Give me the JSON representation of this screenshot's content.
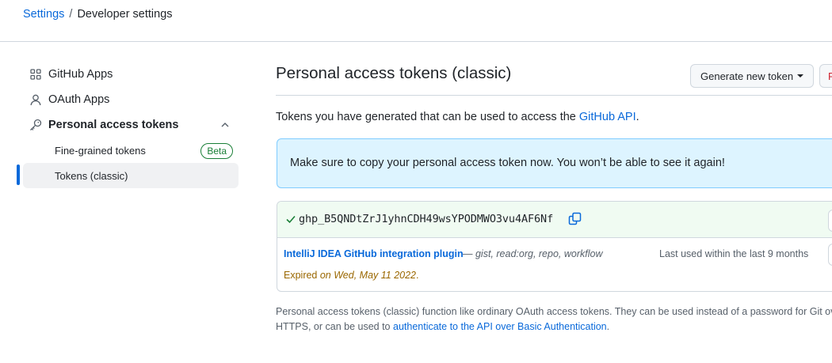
{
  "breadcrumb": {
    "root": "Settings",
    "separator": "/",
    "current": "Developer settings"
  },
  "sidebar": {
    "items": [
      {
        "label": "GitHub Apps",
        "icon": "apps-grid-icon"
      },
      {
        "label": "OAuth Apps",
        "icon": "person-icon"
      },
      {
        "label": "Personal access tokens",
        "icon": "key-icon",
        "expanded": true
      }
    ],
    "subitems": [
      {
        "label": "Fine-grained tokens",
        "badge": "Beta"
      },
      {
        "label": "Tokens (classic)",
        "active": true
      }
    ]
  },
  "main": {
    "title": "Personal access tokens (classic)",
    "generate_label": "Generate new token",
    "revoke_label": "R",
    "intro_text": "Tokens you have generated that can be used to access the ",
    "intro_link": "GitHub API",
    "intro_end": ".",
    "flash": "Make sure to copy your personal access token now. You won’t be able to see it again!",
    "token": {
      "value": "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",
      "name": "IntelliJ IDEA GitHub integration plugin",
      "scope_sep": " — ",
      "scopes": "gist, read:org, repo, workflow",
      "last_used": "Last used within the last 9 months",
      "expired_prefix": "Expired ",
      "expired_date": "on Wed, May 11 2022",
      "expired_suffix": "."
    },
    "footnote_text": "Personal access tokens (classic) function like ordinary OAuth access tokens. They can be used instead of a password for Git over HTTPS, or can be used to ",
    "footnote_link": "authenticate to the API over Basic Authentication",
    "footnote_end": "."
  },
  "colors": {
    "link": "#0969da",
    "success": "#1a7f37",
    "attention": "#9a6700",
    "flash_bg": "#ddf4ff"
  }
}
